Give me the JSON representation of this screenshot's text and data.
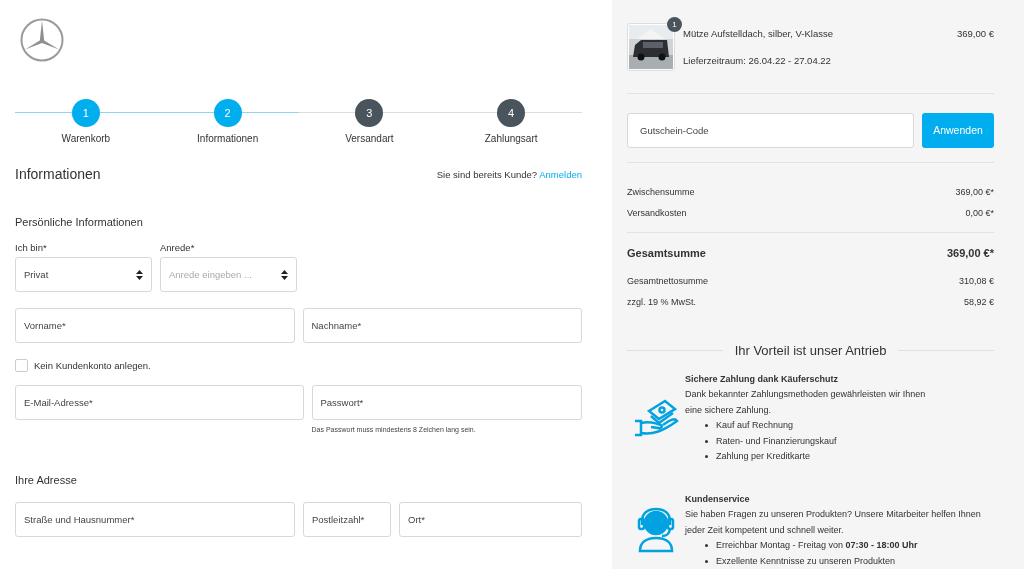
{
  "steps": [
    {
      "number": "1",
      "label": "Warenkorb",
      "completed": true
    },
    {
      "number": "2",
      "label": "Informationen",
      "completed": true
    },
    {
      "number": "3",
      "label": "Versandart",
      "completed": false
    },
    {
      "number": "4",
      "label": "Zahlungsart",
      "completed": false
    }
  ],
  "page_title": "Informationen",
  "login_prompt": "Sie sind bereits Kunde?",
  "login_link": "Anmelden",
  "personal": {
    "heading": "Persönliche Informationen",
    "selects": [
      {
        "label": "Ich bin*",
        "value": "Privat"
      },
      {
        "label": "Anrede*",
        "placeholder": "Anrede eingeben ..."
      }
    ],
    "name_fields": [
      {
        "placeholder": "Vorname*"
      },
      {
        "placeholder": "Nachname*"
      }
    ],
    "no_account": {
      "label": "Kein Kundenkonto anlegen.",
      "checked": false
    },
    "email": {
      "placeholder": "E-Mail-Adresse*"
    },
    "password": {
      "placeholder": "Passwort*",
      "hint": "Das Passwort muss mindestens 8 Zeichen lang sein."
    }
  },
  "address": {
    "heading": "Ihre Adresse",
    "fields": [
      {
        "placeholder": "Straße und Hausnummer*"
      },
      {
        "placeholder": "Postleitzahl*"
      },
      {
        "placeholder": "Ort*"
      }
    ]
  },
  "cart": {
    "item": {
      "quantity": "1",
      "name": "Mütze Aufstelldach, silber, V-Klasse",
      "delivery": "Lieferzeitraum: 26.04.22 - 27.04.22",
      "price": "369,00 €"
    },
    "coupon": {
      "placeholder": "Gutschein-Code",
      "button": "Anwenden"
    },
    "subtotals": [
      {
        "label": "Zwischensumme",
        "value": "369,00 €*"
      },
      {
        "label": "Versandkosten",
        "value": "0,00 €*"
      }
    ],
    "total": {
      "label": "Gesamtsumme",
      "value": "369,00 €*"
    },
    "net": [
      {
        "label": "Gesamtnettosumme",
        "value": "310,08 €"
      },
      {
        "label": "zzgl. 19 % MwSt.",
        "value": "58,92 €"
      }
    ]
  },
  "benefits": {
    "heading": "Ihr Vorteil ist unser Antrieb",
    "items": [
      {
        "kind": "payment",
        "title": "Sichere Zahlung dank Käuferschutz",
        "lines": [
          "Dank bekannter Zahlungsmethoden gewährleisten wir Ihnen",
          "eine sichere Zahlung."
        ],
        "bullets": [
          "Kauf auf Rechnung",
          "Raten- und Finanzierungskauf",
          "Zahlung per Kreditkarte"
        ]
      },
      {
        "kind": "service",
        "title": "Kundenservice",
        "lines": [
          "Sie haben Fragen zu unseren Produkten? Unsere Mitarbeiter helfen Ihnen",
          "jeder Zeit kompetent und schnell weiter."
        ],
        "bullets": [
          "Erreichbar Montag - Freitag von **07:30 - 18:00 Uhr**",
          "Exzellente Kenntnisse zu unseren Produkten"
        ]
      }
    ]
  }
}
